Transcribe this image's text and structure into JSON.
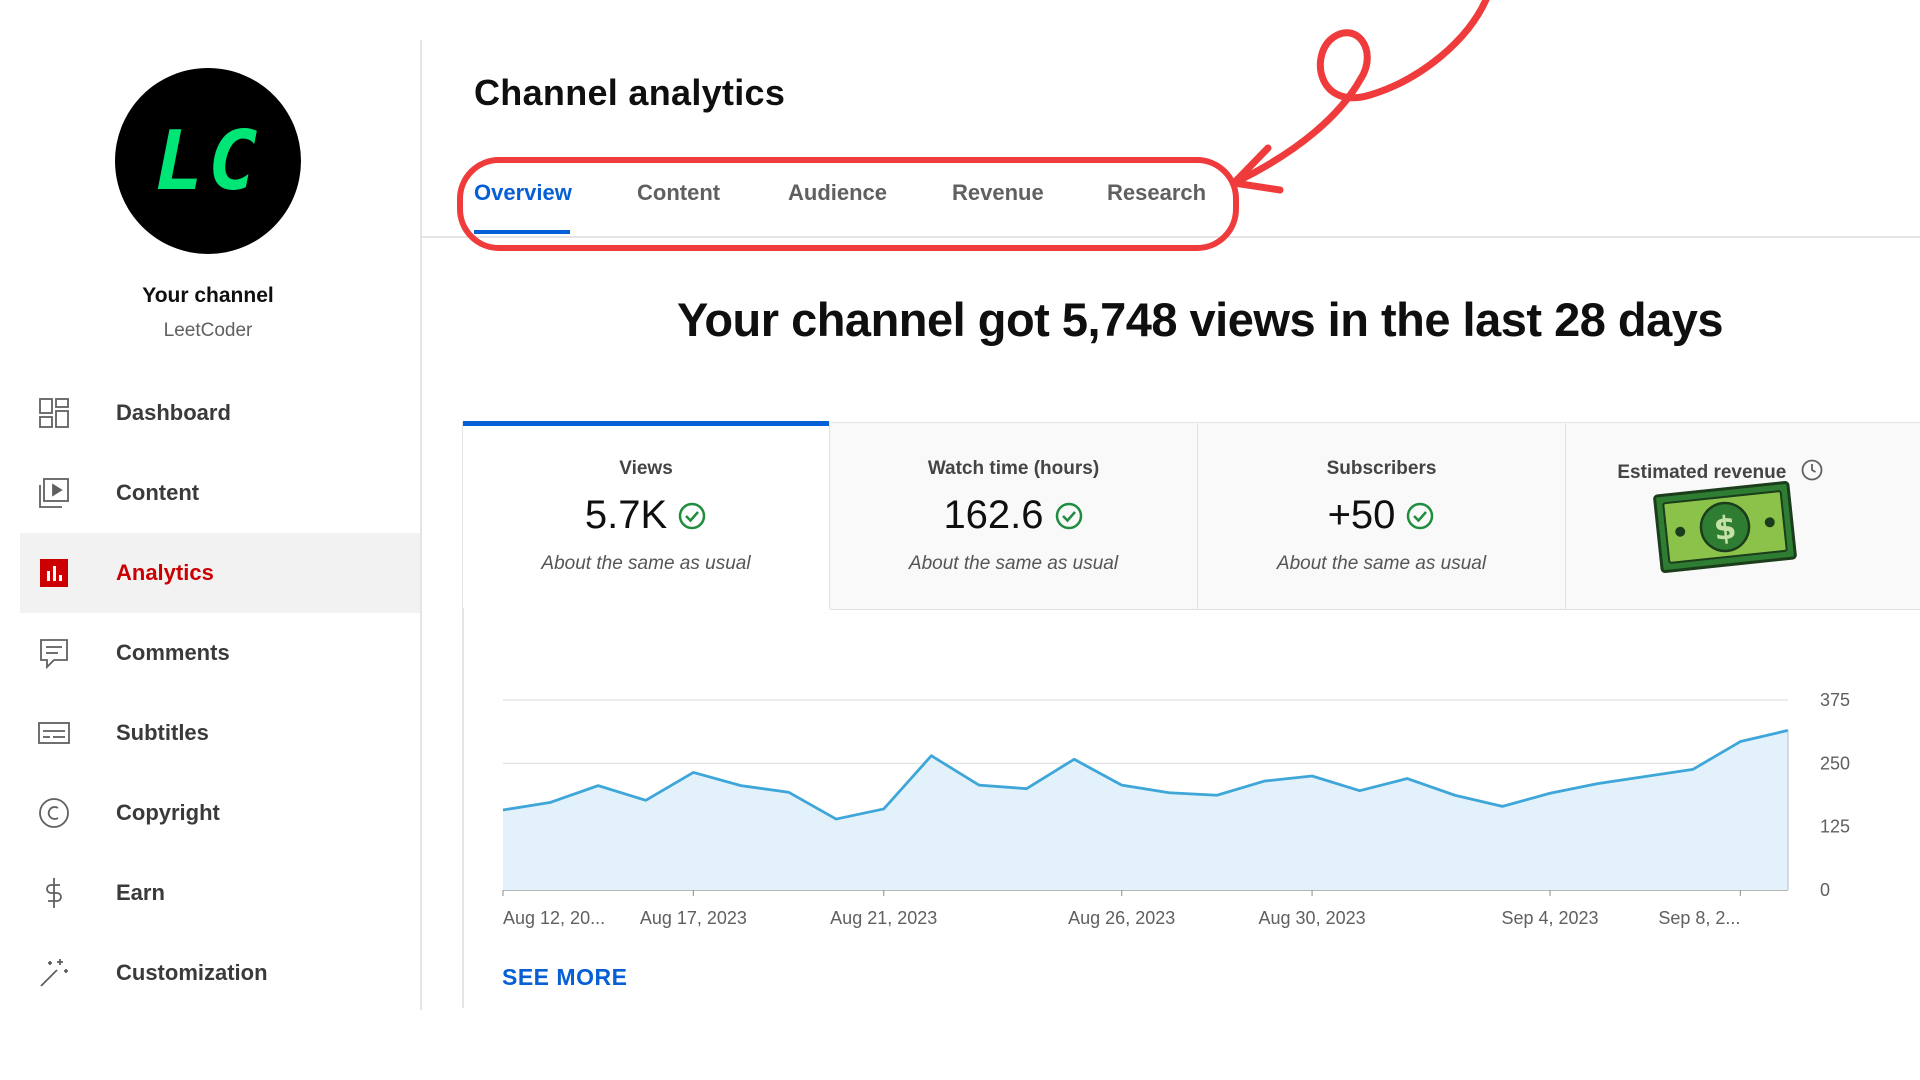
{
  "sidebar": {
    "avatar_text": "LC",
    "channel_title": "Your channel",
    "channel_handle": "LeetCoder",
    "items": [
      {
        "label": "Dashboard",
        "icon": "dashboard-icon"
      },
      {
        "label": "Content",
        "icon": "content-icon"
      },
      {
        "label": "Analytics",
        "icon": "analytics-icon",
        "active": true
      },
      {
        "label": "Comments",
        "icon": "comments-icon"
      },
      {
        "label": "Subtitles",
        "icon": "subtitles-icon"
      },
      {
        "label": "Copyright",
        "icon": "copyright-icon"
      },
      {
        "label": "Earn",
        "icon": "earn-icon"
      },
      {
        "label": "Customization",
        "icon": "customization-icon"
      }
    ]
  },
  "main": {
    "title": "Channel analytics",
    "tabs": [
      {
        "label": "Overview",
        "active": true
      },
      {
        "label": "Content"
      },
      {
        "label": "Audience"
      },
      {
        "label": "Revenue"
      },
      {
        "label": "Research"
      }
    ],
    "headline": "Your channel got 5,748 views in the last 28 days",
    "metrics": [
      {
        "label": "Views",
        "value": "5.7K",
        "note": "About the same as usual",
        "active": true
      },
      {
        "label": "Watch time (hours)",
        "value": "162.6",
        "note": "About the same as usual"
      },
      {
        "label": "Subscribers",
        "value": "+50",
        "note": "About the same as usual"
      },
      {
        "label": "Estimated revenue",
        "icon": "money-icon"
      }
    ],
    "see_more": "SEE MORE"
  },
  "colors": {
    "accent_blue": "#065fd4",
    "active_red": "#cc0000",
    "annotation_red": "#ef3b3b",
    "chart_line": "#3ea6d8",
    "chart_fill": "#e3f2fa",
    "avatar_text": "#00e676"
  },
  "chart_data": {
    "type": "area",
    "x_tick_labels": [
      "Aug 12, 20...",
      "Aug 17, 2023",
      "Aug 21, 2023",
      "Aug 26, 2023",
      "Aug 30, 2023",
      "Sep 4, 2023",
      "Sep 8, 2..."
    ],
    "x_tick_index": [
      0,
      4,
      8,
      13,
      17,
      22,
      26
    ],
    "y_ticks": [
      0,
      125,
      250,
      375
    ],
    "ylim": [
      0,
      375
    ],
    "values": [
      158,
      173,
      206,
      177,
      232,
      206,
      193,
      140,
      160,
      265,
      207,
      200,
      258,
      207,
      192,
      187,
      215,
      225,
      196,
      220,
      187,
      165,
      191,
      210,
      224,
      238,
      293,
      315
    ],
    "grid": true
  }
}
